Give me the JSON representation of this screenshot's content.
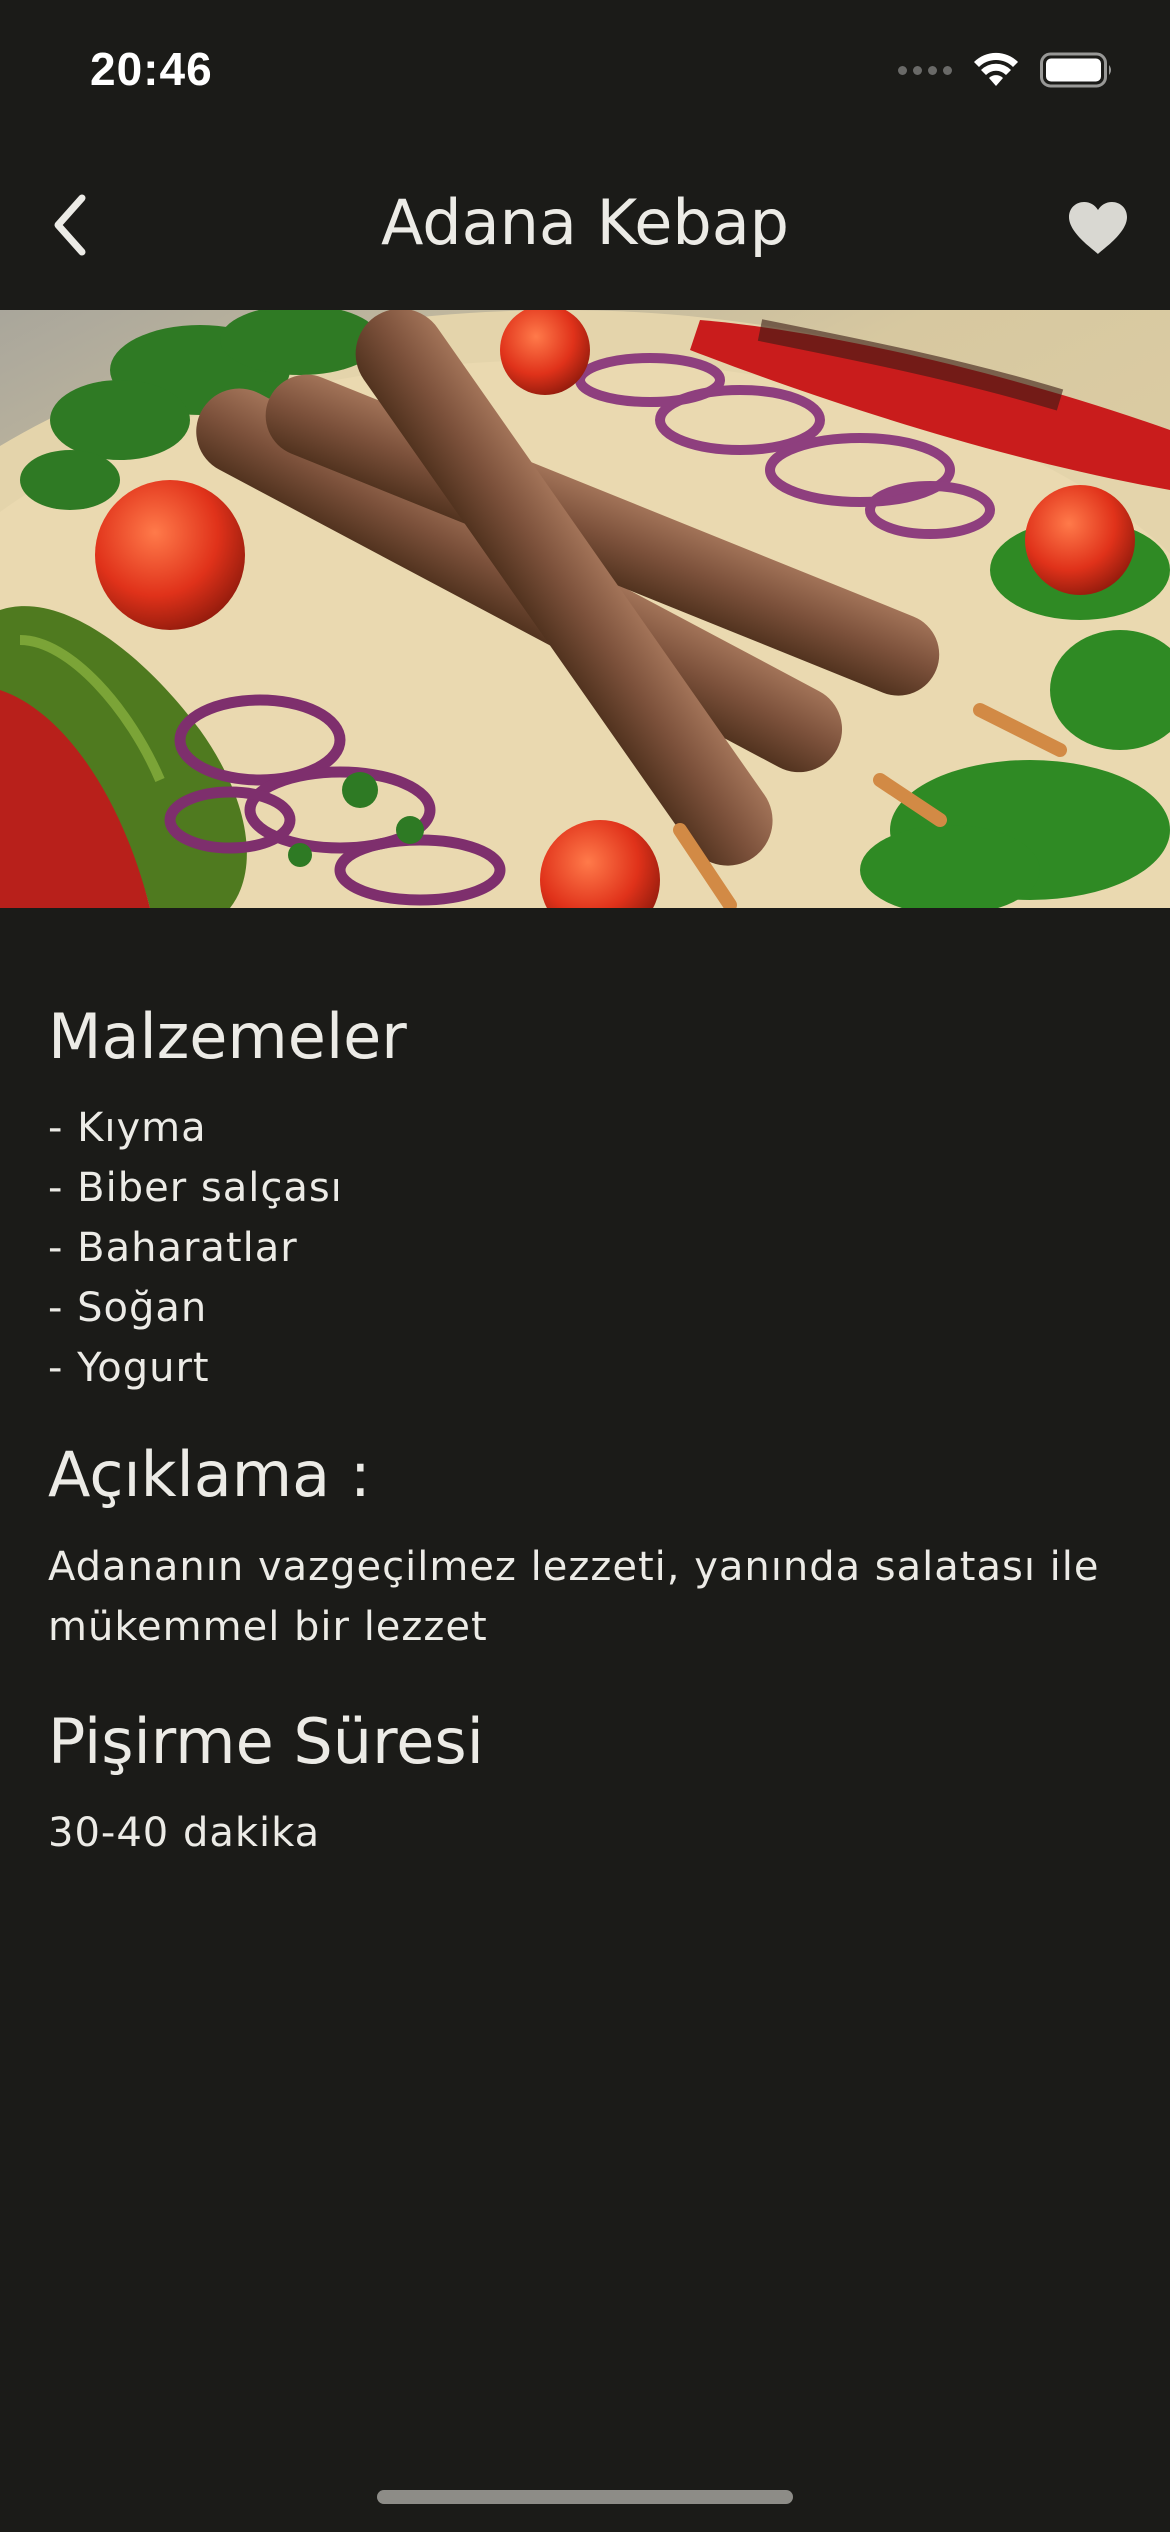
{
  "status_bar": {
    "time": "20:46"
  },
  "nav": {
    "title": "Adana Kebap",
    "back_icon": "chevron-left-icon",
    "favorite_icon": "heart-icon"
  },
  "hero": {
    "image_subject": "Adana kebap skewers with grilled peppers, tomatoes, onions and parsley"
  },
  "ingredients": {
    "title": "Malzemeler",
    "items": [
      "- Kıyma",
      "- Biber salçası",
      "- Baharatlar",
      "- Soğan",
      "- Yogurt"
    ]
  },
  "description": {
    "title": "Açıklama :",
    "text": "Adananın vazgeçilmez lezzeti, yanında salatası ile mükemmel bir lezzet"
  },
  "cooking_time": {
    "title": "Pişirme Süresi",
    "value": "30-40 dakika"
  },
  "colors": {
    "background": "#1b1b18",
    "text": "#ecebe6",
    "icon": "#d9d8d2"
  }
}
